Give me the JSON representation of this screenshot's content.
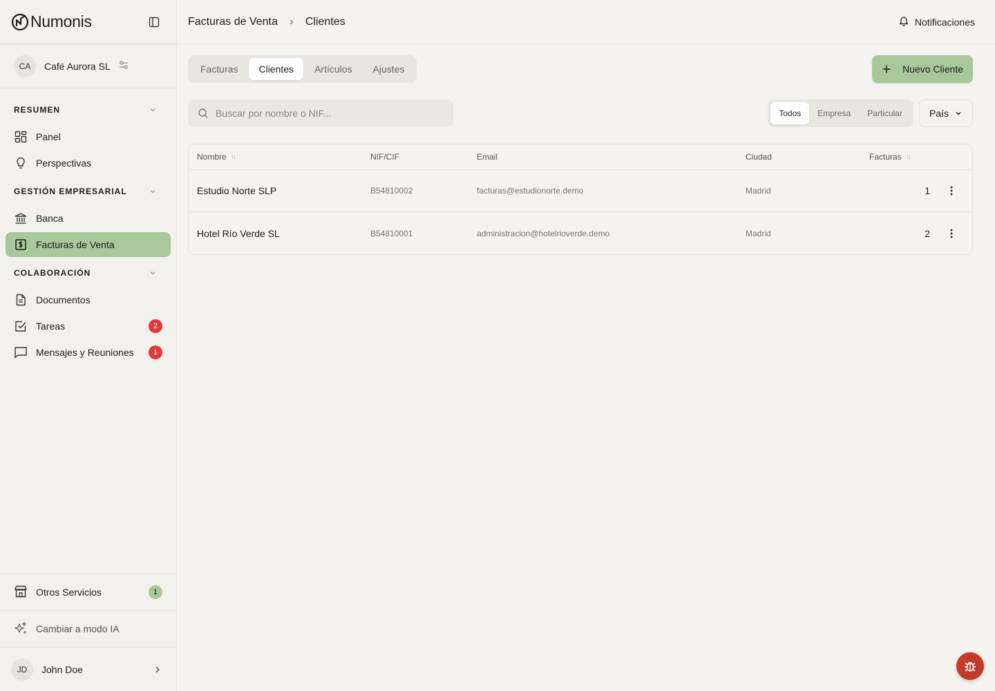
{
  "brand": {
    "name": "Numonis"
  },
  "company": {
    "initials": "CA",
    "name": "Café Aurora SL"
  },
  "sidebar": {
    "sections": [
      {
        "title": "RESUMEN",
        "items": [
          {
            "label": "Panel",
            "icon": "grid-icon"
          },
          {
            "label": "Perspectivas",
            "icon": "lightbulb-icon"
          }
        ]
      },
      {
        "title": "GESTIÓN EMPRESARIAL",
        "items": [
          {
            "label": "Banca",
            "icon": "bank-icon"
          },
          {
            "label": "Facturas de Venta",
            "icon": "invoice-icon",
            "active": true
          }
        ]
      },
      {
        "title": "COLABORACIÓN",
        "items": [
          {
            "label": "Documentos",
            "icon": "document-icon"
          },
          {
            "label": "Tareas",
            "icon": "checkbox-icon",
            "badge": "2"
          },
          {
            "label": "Mensajes y Reuniones",
            "icon": "message-icon",
            "badge": "1"
          }
        ]
      }
    ],
    "footer": {
      "services_label": "Otros Servicios",
      "services_badge": "1",
      "ai_label": "Cambiar a modo IA",
      "user_initials": "JD",
      "user_name": "John Doe"
    }
  },
  "header": {
    "breadcrumb": [
      "Facturas de Venta",
      "Clientes"
    ],
    "notifications_label": "Notificaciones"
  },
  "tabs": [
    {
      "label": "Facturas",
      "active": false
    },
    {
      "label": "Clientes",
      "active": true
    },
    {
      "label": "Artículos",
      "active": false
    },
    {
      "label": "Ajustes",
      "active": false
    }
  ],
  "new_client_label": "Nuevo Cliente",
  "search": {
    "placeholder": "Buscar por nombre o NIF..."
  },
  "type_filter": [
    {
      "label": "Todos",
      "active": true
    },
    {
      "label": "Empresa",
      "active": false
    },
    {
      "label": "Particular",
      "active": false
    }
  ],
  "country_filter_label": "País",
  "table": {
    "columns": [
      "Nombre",
      "NIF/CIF",
      "Email",
      "Ciudad",
      "Facturas"
    ],
    "rows": [
      {
        "name": "Estudio Norte SLP",
        "nif": "B54810002",
        "email": "facturas@estudionorte.demo",
        "city": "Madrid",
        "invoices": "1"
      },
      {
        "name": "Hotel Río Verde SL",
        "nif": "B54810001",
        "email": "administracion@hotelrioverde.demo",
        "city": "Madrid",
        "invoices": "2"
      }
    ]
  },
  "colors": {
    "accent": "#a8c79a",
    "badge_red": "#e03b3b",
    "bug_button": "#c23a2b",
    "background": "#f4f3ef"
  }
}
